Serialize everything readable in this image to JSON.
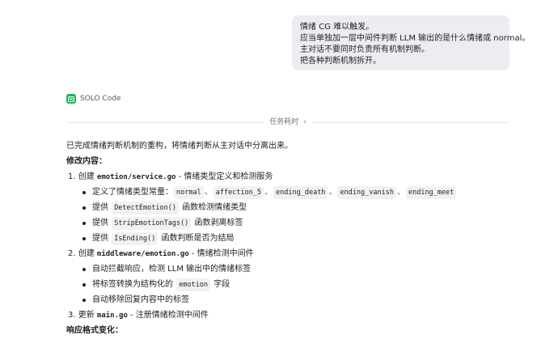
{
  "user_message": {
    "lines": [
      "情绪 CG 难以触发。",
      "应当单独加一层中间件判断 LLM 输出的是什么情绪或 normal。",
      "主对话不要同时负责所有机制判断。",
      "把各种判断机制拆开。"
    ]
  },
  "agent": {
    "name": "SOLO Code"
  },
  "task_divider": {
    "label": "任务耗时",
    "chevron": "›"
  },
  "response": {
    "summary": "已完成情绪判断机制的重构，将情绪判断从主对话中分离出来。",
    "section_changes": "修改内容：",
    "item1": {
      "prefix": "1. 创建 ",
      "file": "emotion/service.go",
      "desc": " - 情绪类型定义和检测服务",
      "sub1_text": "定义了情绪类型常量：",
      "sub1_codes": [
        "normal",
        "affection_5",
        "ending_death",
        "ending_vanish",
        "ending_meet"
      ],
      "sep": "、",
      "sub2_pre": "提供 ",
      "sub2_code": "DetectEmotion()",
      "sub2_post": " 函数检测情绪类型",
      "sub3_pre": "提供 ",
      "sub3_code": "StripEmotionTags()",
      "sub3_post": " 函数剥离标签",
      "sub4_pre": "提供 ",
      "sub4_code": "IsEnding()",
      "sub4_post": " 函数判断是否为结局"
    },
    "item2": {
      "prefix": "2. 创建 ",
      "file": "middleware/emotion.go",
      "desc": " - 情绪检测中间件",
      "sub1": "自动拦截响应，检测 LLM 输出中的情绪标签",
      "sub2_pre": "将标签转换为结构化的 ",
      "sub2_code": "emotion",
      "sub2_post": " 字段",
      "sub3": "自动移除回复内容中的标签"
    },
    "item3": {
      "prefix": "3. 更新 ",
      "file": "main.go",
      "desc": " - 注册情绪检测中间件"
    },
    "section_format": "响应格式变化："
  }
}
